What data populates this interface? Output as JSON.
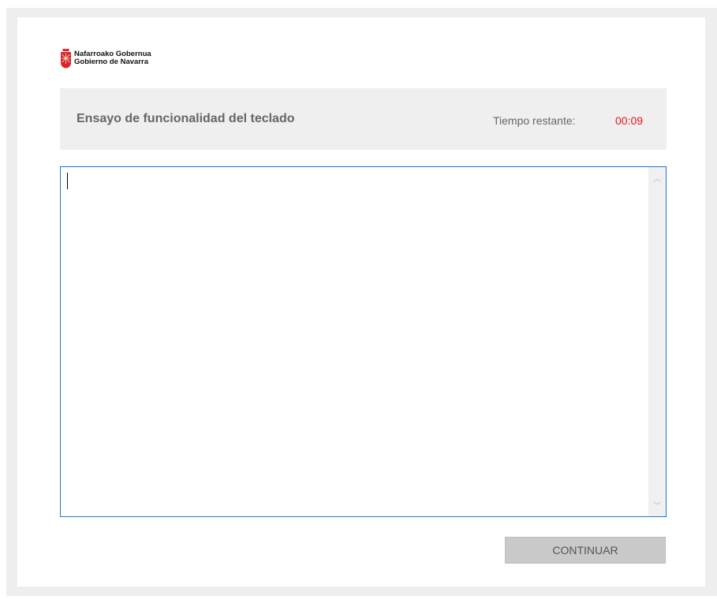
{
  "logo": {
    "line1": "Nafarroako Gobernua",
    "line2": "Gobierno de Navarra",
    "accent": "#d8232a"
  },
  "header": {
    "title": "Ensayo de funcionalidad del teclado",
    "timer_label": "Tiempo restante:",
    "timer_value": "00:09",
    "timer_color": "#e8141b"
  },
  "editor": {
    "value": "",
    "border_color": "#1c7ad1"
  },
  "actions": {
    "continue_label": "CONTINUAR"
  }
}
